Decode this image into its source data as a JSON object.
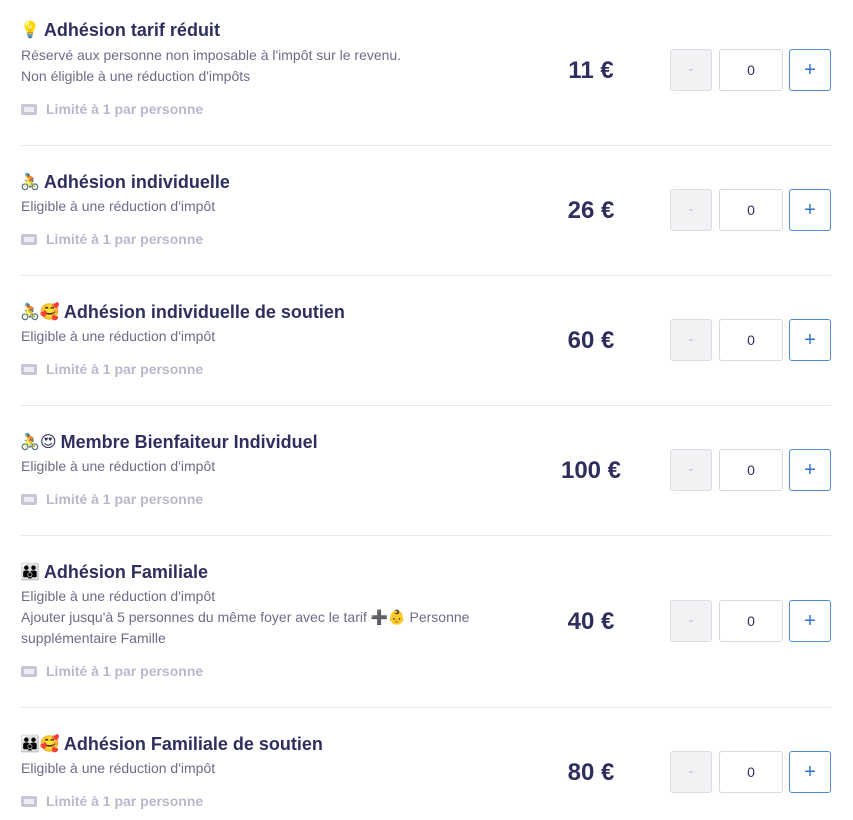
{
  "items": [
    {
      "emoji": "💡",
      "title": "Adhésion tarif réduit",
      "desc_lines": [
        "Réservé aux personne non imposable à l'impôt sur le revenu.",
        "Non éligible à une réduction d'impôts"
      ],
      "limit": "Limité à 1 par personne",
      "price": "11 €",
      "quantity": "0",
      "minus_label": "-",
      "plus_label": "+"
    },
    {
      "emoji": "🚴",
      "title": "Adhésion individuelle",
      "desc_lines": [
        "Eligible à une réduction d'impôt"
      ],
      "limit": "Limité à 1 par personne",
      "price": "26 €",
      "quantity": "0",
      "minus_label": "-",
      "plus_label": "+"
    },
    {
      "emoji": "🚴🥰",
      "title": "Adhésion individuelle de soutien",
      "desc_lines": [
        "Eligible à une réduction d'impôt"
      ],
      "limit": "Limité à 1 par personne",
      "price": "60 €",
      "quantity": "0",
      "minus_label": "-",
      "plus_label": "+"
    },
    {
      "emoji": "🚴😍",
      "title": "Membre Bienfaiteur Individuel",
      "desc_lines": [
        "Eligible à une réduction d'impôt"
      ],
      "limit": "Limité à 1 par personne",
      "price": "100 €",
      "quantity": "0",
      "minus_label": "-",
      "plus_label": "+"
    },
    {
      "emoji": "👪",
      "title": "Adhésion Familiale",
      "desc_lines": [
        "Eligible à une réduction d'impôt",
        "Ajouter jusqu'à 5 personnes du même foyer avec le tarif ➕👶 Personne",
        "supplémentaire Famille"
      ],
      "limit": "Limité à 1 par personne",
      "price": "40 €",
      "quantity": "0",
      "minus_label": "-",
      "plus_label": "+"
    },
    {
      "emoji": "👪🥰",
      "title": "Adhésion Familiale de soutien",
      "desc_lines": [
        "Eligible à une réduction d'impôt"
      ],
      "limit": "Limité à 1 par personne",
      "price": "80 €",
      "quantity": "0",
      "minus_label": "-",
      "plus_label": "+"
    }
  ]
}
